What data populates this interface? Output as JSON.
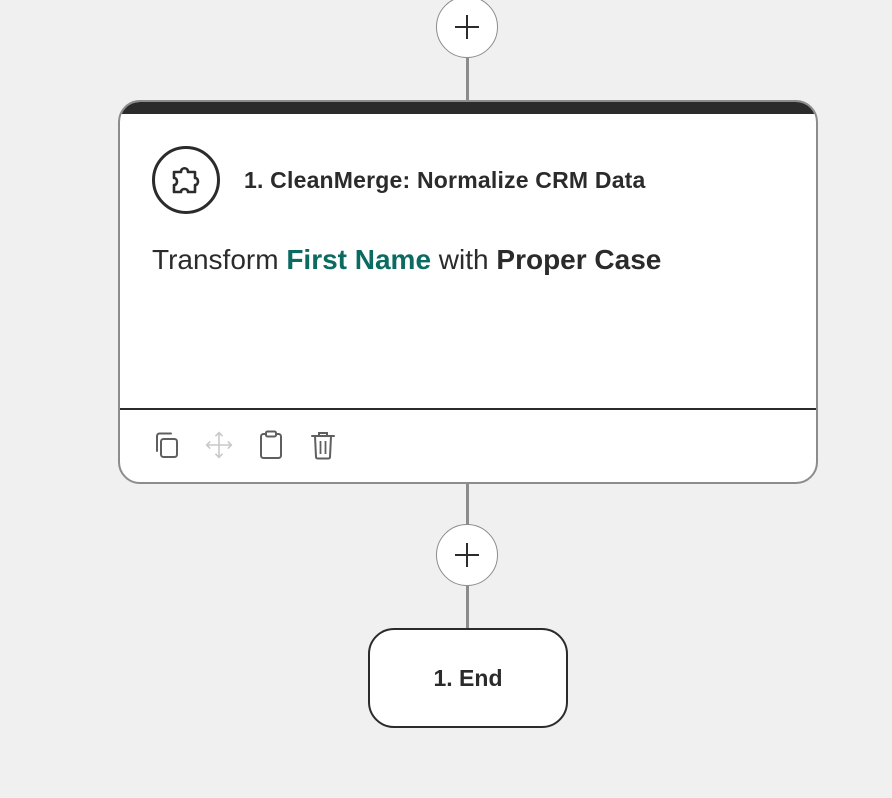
{
  "flow": {
    "add_step_top": {
      "icon": "plus-icon"
    },
    "add_step_between": {
      "icon": "plus-icon"
    },
    "step": {
      "icon": "puzzle-piece-icon",
      "title": "1. CleanMerge: Normalize CRM Data",
      "summary": {
        "prefix": "Transform ",
        "field": "First Name",
        "middle": " with ",
        "operation": "Proper Case"
      },
      "toolbar": [
        {
          "icon": "copy-icon",
          "enabled": true
        },
        {
          "icon": "move-icon",
          "enabled": false
        },
        {
          "icon": "clipboard-icon",
          "enabled": true
        },
        {
          "icon": "trash-icon",
          "enabled": true
        }
      ]
    },
    "end_node": {
      "label": "1. End"
    }
  },
  "colors": {
    "background": "#f0f0f0",
    "card_border": "#8c8c8c",
    "dark": "#2b2b2b",
    "field_accent": "#0b6b63",
    "disabled_icon": "#c8c8c8"
  }
}
